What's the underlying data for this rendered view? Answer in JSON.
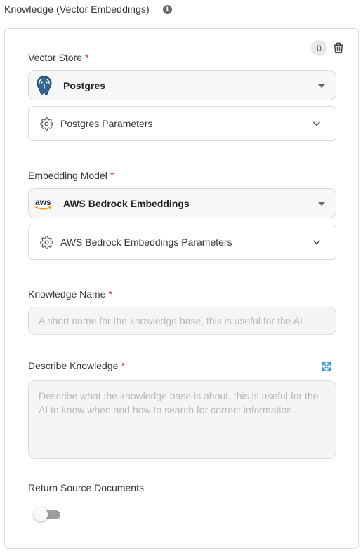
{
  "section": {
    "title": "Knowledge (Vector Embeddings)",
    "info_icon": "i"
  },
  "card": {
    "count": "0",
    "vector_store": {
      "label": "Vector Store",
      "required_mark": "*",
      "selected": "Postgres",
      "logo": "postgres-elephant-logo",
      "params_label": "Postgres Parameters"
    },
    "embedding_model": {
      "label": "Embedding Model",
      "required_mark": "*",
      "selected": "AWS Bedrock Embeddings",
      "logo_text": "aws",
      "params_label": "AWS Bedrock Embeddings Parameters"
    },
    "knowledge_name": {
      "label": "Knowledge Name",
      "required_mark": "*",
      "value": "",
      "placeholder": "A short name for the knowledge base, this is useful for the AI"
    },
    "describe_knowledge": {
      "label": "Describe Knowledge",
      "required_mark": "*",
      "value": "",
      "placeholder": "Describe what the knowledge base is about, this is useful for the AI to know when and how to search for correct information"
    },
    "return_source": {
      "label": "Return Source Documents",
      "enabled": false
    }
  },
  "colors": {
    "required": "#d32f2f",
    "expand_icon": "#1e88e5",
    "aws_orange": "#ff9900",
    "postgres_blue": "#336791"
  }
}
